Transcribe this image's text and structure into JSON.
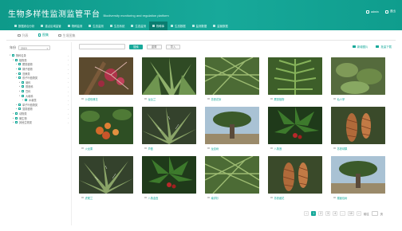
{
  "header": {
    "title_cn": "生物多样性监测监管平台",
    "title_en": "Biodiversity monitoring and regulation platform",
    "user": {
      "name": "admin",
      "action": "退出"
    }
  },
  "nav": [
    {
      "label": "数据综合分析",
      "active": false
    },
    {
      "label": "重点区域监管",
      "active": false
    },
    {
      "label": "物种监测",
      "active": false
    },
    {
      "label": "生态监测",
      "active": false
    },
    {
      "label": "生态系统",
      "active": false
    },
    {
      "label": "生态监测",
      "active": false
    },
    {
      "label": "物种库",
      "active": true
    },
    {
      "label": "生态数据",
      "active": false
    },
    {
      "label": "监测数据",
      "active": false
    },
    {
      "label": "监管数据",
      "active": false
    }
  ],
  "tabs": [
    {
      "label": "列表",
      "active": false
    },
    {
      "label": "图集",
      "active": true
    },
    {
      "label": "生境图集",
      "active": false
    }
  ],
  "sidebar": {
    "year_label": "年份",
    "year_value": "2019",
    "tree": [
      {
        "label": "物种名录",
        "level": 0,
        "open": true
      },
      {
        "label": "植物类",
        "level": 1,
        "open": true
      },
      {
        "label": "蕨类植物",
        "level": 2,
        "open": false
      },
      {
        "label": "裸子植物",
        "level": 2,
        "open": false
      },
      {
        "label": "苔藓类",
        "level": 2,
        "open": false
      },
      {
        "label": "双子叶植物类",
        "level": 2,
        "open": true
      },
      {
        "label": "菊科",
        "level": 3,
        "open": false
      },
      {
        "label": "蔷薇科",
        "level": 3,
        "open": false
      },
      {
        "label": "豆科",
        "level": 3,
        "open": false
      },
      {
        "label": "大戟科",
        "level": 3,
        "open": true
      },
      {
        "label": "木薯属",
        "level": 4,
        "open": false
      },
      {
        "label": "单子叶植物类",
        "level": 2,
        "open": false
      },
      {
        "label": "藻类植物",
        "level": 2,
        "open": false
      },
      {
        "label": "动物类",
        "level": 1,
        "open": false
      },
      {
        "label": "微生物",
        "level": 1,
        "open": false
      },
      {
        "label": "其他生物类",
        "level": 1,
        "open": false
      }
    ]
  },
  "toolbar": {
    "search_placeholder": "",
    "search_button": "搜索",
    "reset_button": "重置",
    "import_button": "导入",
    "right_actions": [
      "新增图片",
      "批量下载"
    ]
  },
  "gallery": [
    {
      "caption": "沙漠玫瑰花",
      "motif": "flower"
    },
    {
      "caption": "龙舌兰",
      "motif": "agave"
    },
    {
      "caption": "苏铁花序",
      "motif": "conifer"
    },
    {
      "caption": "蕨类植物",
      "motif": "fern"
    },
    {
      "caption": "仙人掌",
      "motif": "leafy"
    },
    {
      "caption": "火龙果",
      "motif": "berries"
    },
    {
      "caption": "芦荟",
      "motif": "aloe"
    },
    {
      "caption": "龙血树",
      "motif": "tree"
    },
    {
      "caption": "八角莲",
      "motif": "palmate"
    },
    {
      "caption": "苏铁球果",
      "motif": "cone"
    },
    {
      "caption": "虎尾兰",
      "motif": "aloe"
    },
    {
      "caption": "八角金盘",
      "motif": "palmate"
    },
    {
      "caption": "南洋杉",
      "motif": "conifer"
    },
    {
      "caption": "苏铁雌花",
      "motif": "cone"
    },
    {
      "caption": "猴面包树",
      "motif": "tree"
    }
  ],
  "pager": {
    "prev": "<",
    "pages": [
      "1",
      "2",
      "3",
      "4",
      "...",
      "10"
    ],
    "active_page": "1",
    "next": ">",
    "goto_label": "前往",
    "page_suffix": "页"
  },
  "colors": {
    "primary": "#17a99a",
    "header_dark": "#0a7d70"
  }
}
